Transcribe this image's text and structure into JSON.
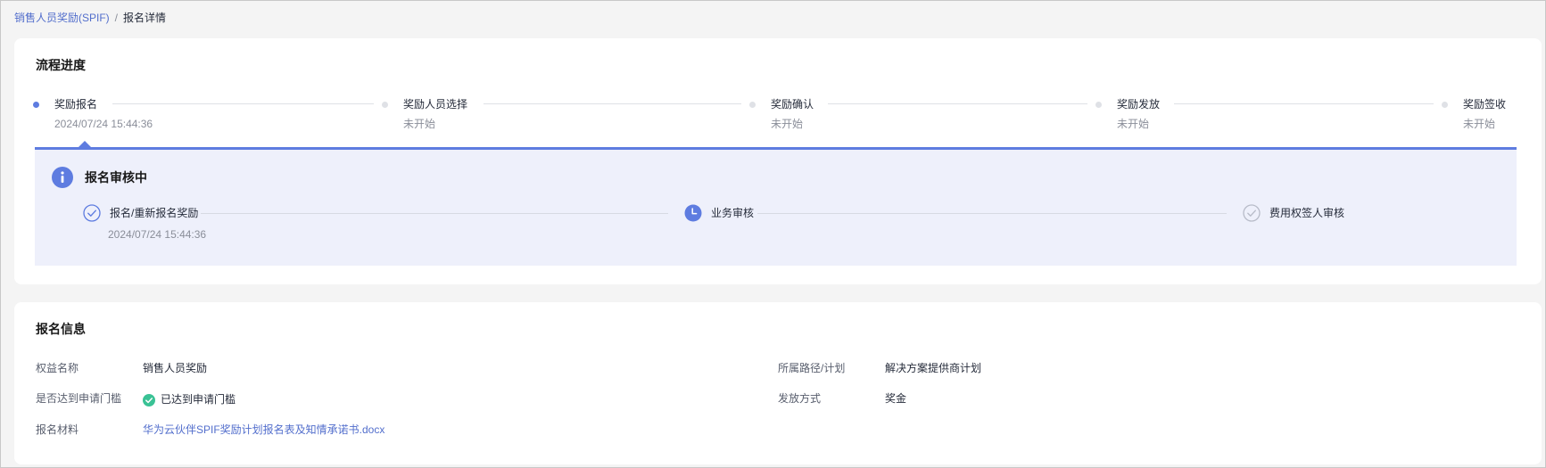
{
  "breadcrumb": {
    "parent": "销售人员奖励(SPIF)",
    "separator": "/",
    "current": "报名详情"
  },
  "progress": {
    "title": "流程进度",
    "steps": [
      {
        "name": "奖励报名",
        "sub": "2024/07/24 15:44:36",
        "status": "active"
      },
      {
        "name": "奖励人员选择",
        "sub": "未开始",
        "status": "pending"
      },
      {
        "name": "奖励确认",
        "sub": "未开始",
        "status": "pending"
      },
      {
        "name": "奖励发放",
        "sub": "未开始",
        "status": "pending"
      },
      {
        "name": "奖励签收",
        "sub": "未开始",
        "status": "pending"
      }
    ],
    "panel": {
      "title": "报名审核中",
      "icon": "info-icon",
      "steps": [
        {
          "name": "报名/重新报名奖励",
          "sub": "2024/07/24 15:44:36",
          "icon": "check-circle-icon"
        },
        {
          "name": "业务审核",
          "sub": "",
          "icon": "clock-icon"
        },
        {
          "name": "费用权签人审核",
          "sub": "",
          "icon": "check-circle-icon"
        }
      ]
    }
  },
  "info": {
    "title": "报名信息",
    "fields": [
      {
        "label": "权益名称",
        "value": "销售人员奖励"
      },
      {
        "label": "是否达到申请门槛",
        "value": "已达到申请门槛"
      },
      {
        "label": "报名材料",
        "value": "华为云伙伴SPIF奖励计划报名表及知情承诺书.docx"
      },
      {
        "label": "所属路径/计划",
        "value": "解决方案提供商计划"
      },
      {
        "label": "发放方式",
        "value": "奖金"
      }
    ]
  },
  "colors": {
    "accent": "#5e7ce0",
    "link": "#526ecc",
    "success": "#3ac295",
    "panel_bg": "#eef0fb"
  }
}
